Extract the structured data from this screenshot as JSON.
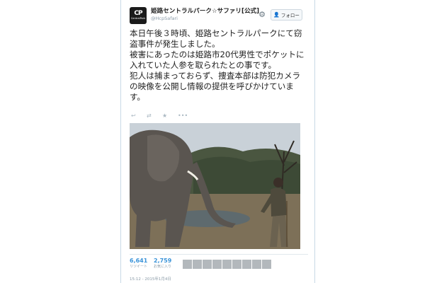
{
  "account": {
    "display_name": "姫路セントラルパーク☆サファリ[公式]",
    "handle": "@HcpSafari",
    "logo_mark": "CP",
    "logo_text": "CentralPark"
  },
  "follow_button": {
    "label": "フォロー"
  },
  "tweet": {
    "paragraphs": [
      "本日午後３時頃、姫路セントラルパークにて窃盗事件が発生しました。",
      "被害にあったのは姫路市20代男性でポケットに入れていた人参を取られたとの事です。",
      "犯人は捕まっておらず、捜査本部は防犯カメラの映像を公開し情報の提供を呼びかけています。"
    ]
  },
  "icons": {
    "reply": "↩",
    "retweet": "⇄",
    "favorite": "★",
    "more": "•••",
    "gear": "⚙",
    "follow": "👤"
  },
  "stats": {
    "retweets": {
      "count": "6,641",
      "label": "リツイート"
    },
    "favorites": {
      "count": "2,759",
      "label": "お気に入り"
    }
  },
  "timestamp": "15:12 - 2015年1月4日",
  "colors": {
    "link": "#3b94d9",
    "border": "#c9d9e6",
    "muted": "#8899a6"
  }
}
